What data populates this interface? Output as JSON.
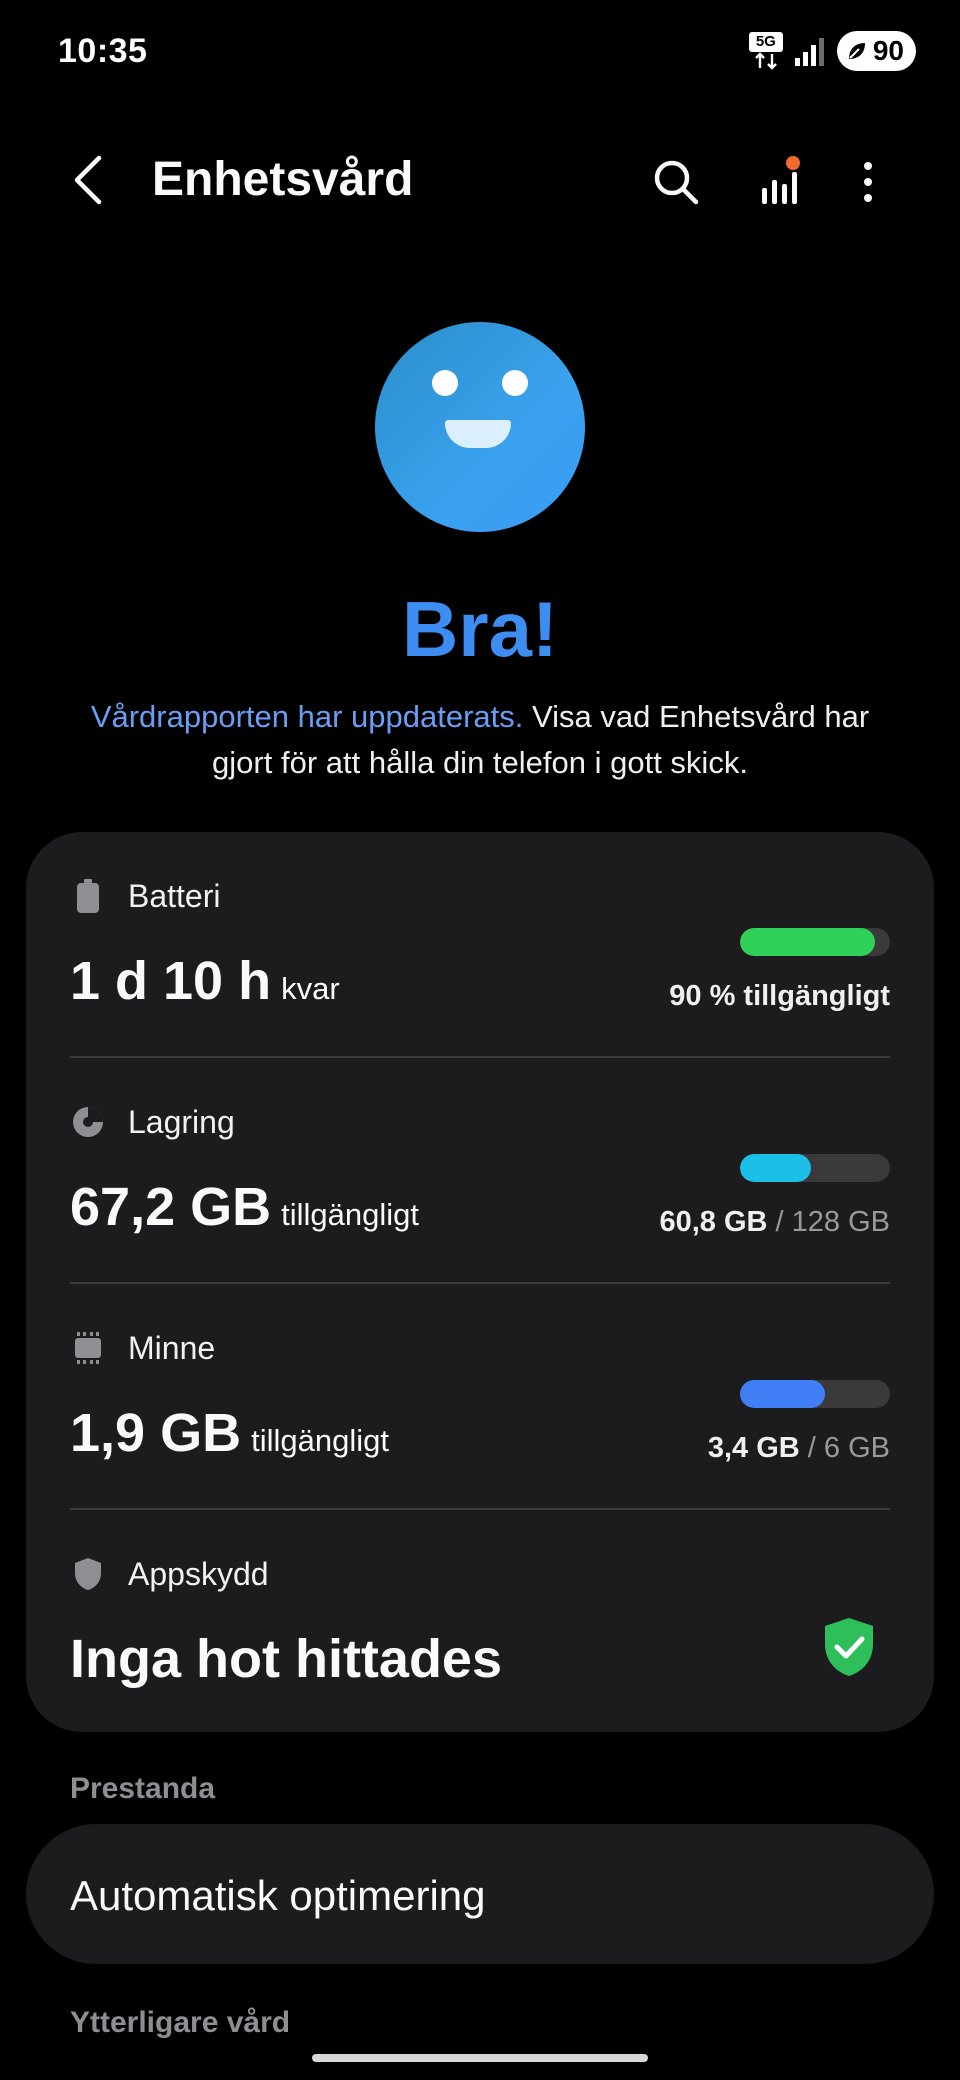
{
  "status_bar": {
    "time": "10:35",
    "network": "5G",
    "battery_level": "90"
  },
  "header": {
    "title": "Enhetsvård",
    "icons": [
      "back-arrow-icon",
      "search-icon",
      "bar-chart-icon",
      "more-vertical-icon"
    ],
    "notification_dot_color": "#f26a2e"
  },
  "status": {
    "title": "Bra!",
    "link_text": "Vårdrapporten har uppdaterats.",
    "description": " Visa vad Enhetsvård har gjort för att hålla din telefon i gott skick.",
    "accent": "#3e8df3",
    "link_color": "#6a9ef5"
  },
  "summary": {
    "battery": {
      "label": "Batteri",
      "value": "1 d 10 h",
      "unit": "kvar",
      "status": "90 % tillgängligt",
      "fill_fraction": 0.9,
      "color": "#30d158"
    },
    "storage": {
      "label": "Lagring",
      "value": "67,2 GB",
      "unit": "tillgängligt",
      "used": "60,8 GB",
      "sep": "/",
      "total": "128 GB",
      "fill_fraction": 0.475,
      "color": "#1cc0e6"
    },
    "memory": {
      "label": "Minne",
      "value": "1,9 GB",
      "unit": "tillgängligt",
      "used": "3,4 GB",
      "sep": "/",
      "total": "6 GB",
      "fill_fraction": 0.567,
      "color": "#3f7ef5"
    },
    "app_protection": {
      "label": "Appskydd",
      "value": "Inga hot hittades",
      "ok_color": "#2fbf5a"
    }
  },
  "sections": {
    "performance_header": "Prestanda",
    "auto_optimize": "Automatisk optimering",
    "more_care_header": "Ytterligare vård"
  }
}
